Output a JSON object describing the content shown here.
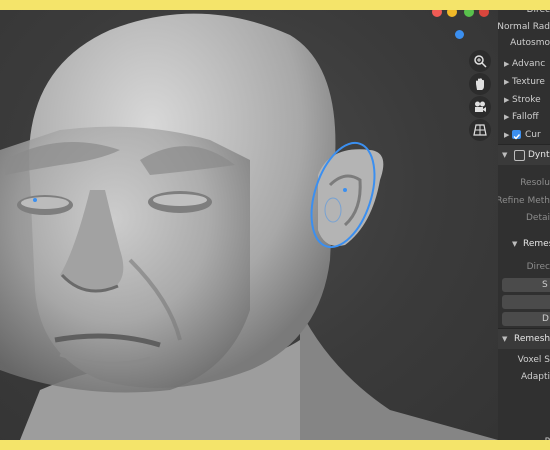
{
  "viewport": {
    "window_buttons": [
      {
        "name": "red",
        "color": "#ef5b55"
      },
      {
        "name": "yellow",
        "color": "#f0b929"
      },
      {
        "name": "green",
        "color": "#59c14c"
      },
      {
        "name": "close",
        "color": "#d9463d"
      }
    ],
    "navigation_tools": [
      "zoom-icon",
      "hand-pan-icon",
      "camera-icon",
      "grid-icon"
    ],
    "accent_color": "#3b8ff0"
  },
  "panel": {
    "properties": [
      {
        "label": "Direc"
      },
      {
        "label": "Normal Rad"
      },
      {
        "label": "Autosmo"
      }
    ],
    "brush_subpanels": [
      {
        "label": "Advanc"
      },
      {
        "label": "Texture"
      },
      {
        "label": "Stroke"
      },
      {
        "label": "Falloff"
      },
      {
        "label": "Cur",
        "checked": true
      }
    ],
    "dyntopo": {
      "title": "Dyntop",
      "enabled": false,
      "fields": [
        {
          "label": "Resolu"
        },
        {
          "label": "Refine Meth"
        },
        {
          "label": "Detai"
        }
      ]
    },
    "remesh_sub": {
      "title": "Remesh",
      "field_label": "Direc",
      "buttons": [
        "S",
        "",
        "D"
      ]
    },
    "remesh": {
      "title": "Remesh",
      "fields": [
        {
          "label": "Voxel S"
        },
        {
          "label": "Adapti"
        }
      ],
      "footer": "P"
    }
  }
}
